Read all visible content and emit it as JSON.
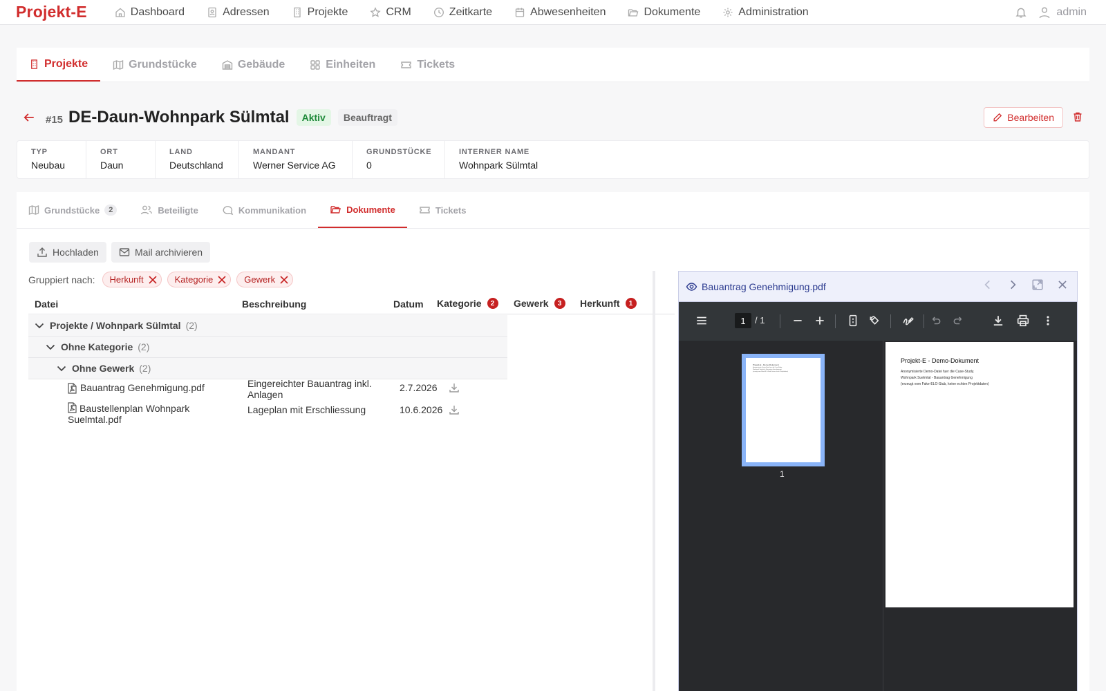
{
  "brand": "Projekt-E",
  "nav": [
    {
      "label": "Dashboard",
      "icon": "home-icon"
    },
    {
      "label": "Adressen",
      "icon": "contact-book-icon"
    },
    {
      "label": "Projekte",
      "icon": "building-icon"
    },
    {
      "label": "CRM",
      "icon": "star-icon"
    },
    {
      "label": "Zeitkarte",
      "icon": "clock-icon"
    },
    {
      "label": "Abwesenheiten",
      "icon": "calendar-icon"
    },
    {
      "label": "Dokumente",
      "icon": "folder-icon"
    },
    {
      "label": "Administration",
      "icon": "gear-icon"
    }
  ],
  "user": {
    "name": "admin"
  },
  "entity_tabs": [
    "Projekte",
    "Grundstücke",
    "Gebäude",
    "Einheiten",
    "Tickets"
  ],
  "project": {
    "id": "#15",
    "title": "DE-Daun-Wohnpark Sülmtal",
    "status": "Aktiv",
    "phase": "Beauftragt",
    "edit_label": "Bearbeiten"
  },
  "info": [
    {
      "key": "TYP",
      "value": "Neubau"
    },
    {
      "key": "ORT",
      "value": "Daun"
    },
    {
      "key": "LAND",
      "value": "Deutschland"
    },
    {
      "key": "MANDANT",
      "value": "Werner Service AG"
    },
    {
      "key": "GRUNDSTÜCKE",
      "value": "0"
    },
    {
      "key": "INTERNER NAME",
      "value": "Wohnpark Sülmtal"
    }
  ],
  "sub_tabs": [
    {
      "label": "Grundstücke",
      "count": "2"
    },
    {
      "label": "Beteiligte"
    },
    {
      "label": "Kommunikation"
    },
    {
      "label": "Dokumente"
    },
    {
      "label": "Tickets"
    }
  ],
  "toolbar": {
    "upload": "Hochladen",
    "mail": "Mail archivieren"
  },
  "grouping": {
    "label": "Gruppiert nach:",
    "chips": [
      "Herkunft",
      "Kategorie",
      "Gewerk"
    ]
  },
  "table": {
    "headers": {
      "datei": "Datei",
      "beschreibung": "Beschreibung",
      "datum": "Datum",
      "kategorie": "Kategorie",
      "kategorie_badge": "2",
      "gewerk": "Gewerk",
      "gewerk_badge": "3",
      "herkunft": "Herkunft",
      "herkunft_badge": "1"
    },
    "groups": [
      {
        "label": "Projekte / Wohnpark Sülmtal",
        "count": "(2)"
      },
      {
        "label": "Ohne Kategorie",
        "count": "(2)"
      },
      {
        "label": "Ohne Gewerk",
        "count": "(2)"
      }
    ],
    "rows": [
      {
        "file": "Bauantrag Genehmigung.pdf",
        "desc": "Eingereichter Bauantrag inkl. Anlagen",
        "date": "2.7.2026"
      },
      {
        "file": "Baustellenplan Wohnpark Suelmtal.pdf",
        "desc": "Lageplan mit Erschliessung",
        "date": "10.6.2026"
      }
    ]
  },
  "preview": {
    "filename": "Bauantrag Genehmigung.pdf",
    "page_current": "1",
    "page_total": "/   1",
    "thumb_label": "1",
    "doc_title": "Projekt-E - Demo-Dokument",
    "doc_lines": [
      "Anonymisierte Demo-Datei fuer die Case-Study.",
      "Wohnpark Suelmtal - Bauantrag Genehmigung",
      "(erzeugt vom Fake-ELO-Stub, keine echten Projektdaten)"
    ]
  },
  "colors": {
    "accent": "#d12d2d",
    "preview_header": "#eef0fb",
    "pdf_toolbar": "#323639"
  }
}
